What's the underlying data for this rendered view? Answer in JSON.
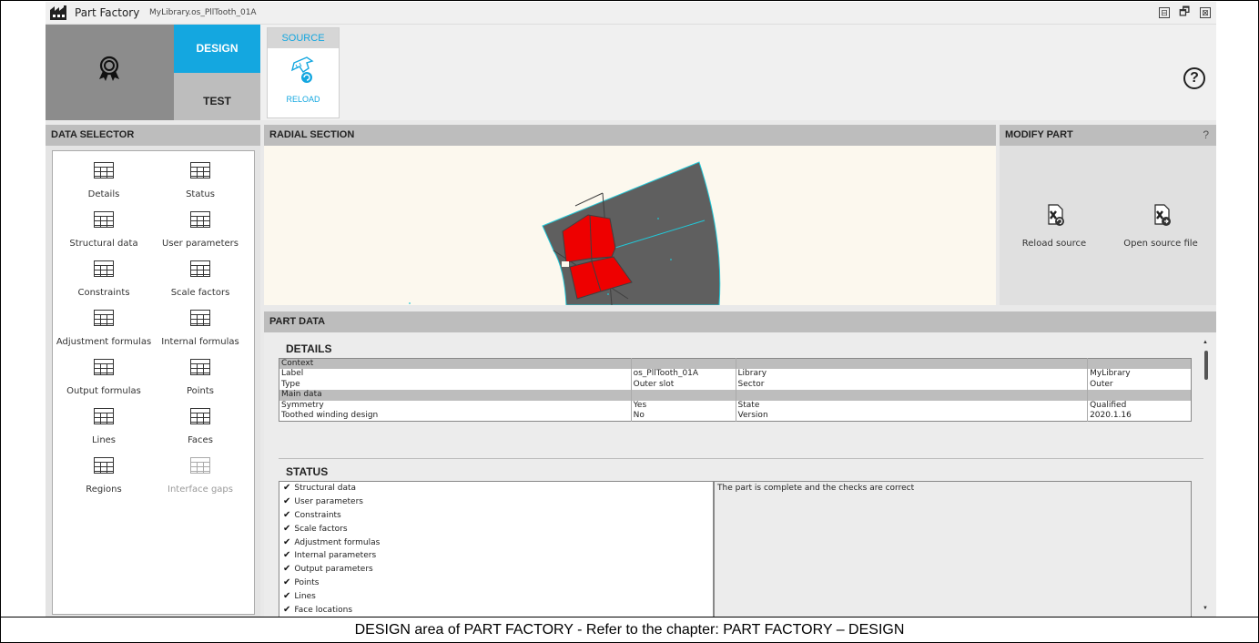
{
  "app": {
    "title": "Part Factory",
    "document": "MyLibrary.os_PllTooth_01A",
    "window_buttons": [
      "⊟",
      "🗗",
      "⊠"
    ]
  },
  "ribbon": {
    "design_tab": "DESIGN",
    "test_tab": "TEST",
    "source_group": "SOURCE",
    "reload_label": "RELOAD",
    "help_label": "?",
    "accent_color": "#14a7e0"
  },
  "data_selector": {
    "title": "DATA SELECTOR",
    "items": [
      {
        "label": "Details",
        "enabled": true
      },
      {
        "label": "Status",
        "enabled": true
      },
      {
        "label": "Structural data",
        "enabled": true
      },
      {
        "label": "User parameters",
        "enabled": true
      },
      {
        "label": "Constraints",
        "enabled": true
      },
      {
        "label": "Scale factors",
        "enabled": true
      },
      {
        "label": "Adjustment formulas",
        "enabled": true
      },
      {
        "label": "Internal formulas",
        "enabled": true
      },
      {
        "label": "Output formulas",
        "enabled": true
      },
      {
        "label": "Points",
        "enabled": true
      },
      {
        "label": "Lines",
        "enabled": true
      },
      {
        "label": "Faces",
        "enabled": true
      },
      {
        "label": "Regions",
        "enabled": true
      },
      {
        "label": "Interface gaps",
        "enabled": false
      }
    ]
  },
  "radial_section": {
    "title": "RADIAL SECTION",
    "region_colors": {
      "iron": "#5f5f5f",
      "winding": "#ee0000",
      "outline": "#22c8d8"
    }
  },
  "modify_part": {
    "title": "MODIFY PART",
    "help": "?",
    "actions": [
      "Reload source",
      "Open source file"
    ]
  },
  "part_data": {
    "title": "PART DATA",
    "details": {
      "title": "DETAILS",
      "context_label": "Context",
      "main_label": "Main data",
      "rows": {
        "r1": [
          "Label",
          "os_PllTooth_01A",
          "Library",
          "MyLibrary"
        ],
        "r2": [
          "Type",
          "Outer slot",
          "Sector",
          "Outer"
        ],
        "r3": [
          "Symmetry",
          "Yes",
          "State",
          "Qualified"
        ],
        "r4": [
          "Toothed winding design",
          "No",
          "Version",
          "2020.1.16"
        ]
      }
    },
    "status": {
      "title": "STATUS",
      "checks": [
        "Structural data",
        "User parameters",
        "Constraints",
        "Scale factors",
        "Adjustment formulas",
        "Internal parameters",
        "Output parameters",
        "Points",
        "Lines",
        "Face locations"
      ],
      "message": "The part is complete and the checks are correct"
    }
  },
  "caption": "DESIGN area of PART FACTORY - Refer to the chapter: PART FACTORY – DESIGN"
}
